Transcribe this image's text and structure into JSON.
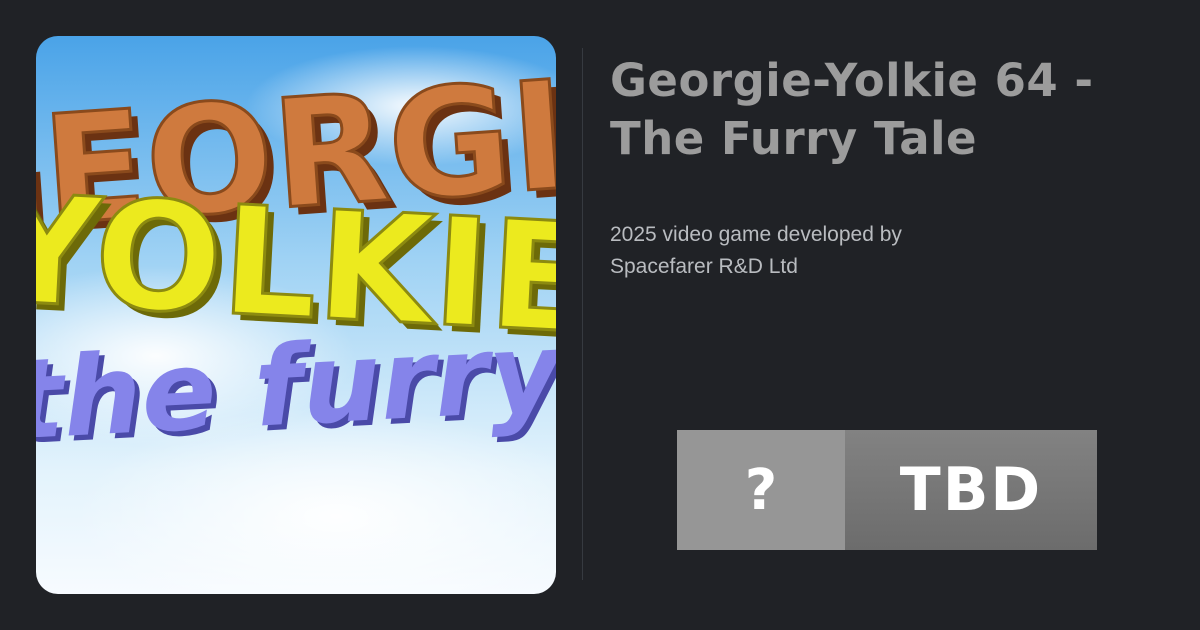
{
  "cover": {
    "logo_line1": "GEORGIE",
    "logo_line2": "YOLKIE",
    "logo_line3": "the furry"
  },
  "game": {
    "title_line1": "Georgie-Yolkie 64 -",
    "title_line2": "The Furry Tale",
    "description_line1": "2025 video game developed by",
    "description_line2": "Spacefarer R&D Ltd"
  },
  "score": {
    "user_symbol": "?",
    "critic_label": "TBD"
  },
  "colors": {
    "background": "#202226",
    "title": "#9c9c9c",
    "description": "#b9bcc0",
    "score_left": "#969696",
    "score_right": "#767676",
    "logo_orange": "#cf7a3e",
    "logo_yellow": "#ecea1e",
    "logo_purple": "#8584ea"
  }
}
